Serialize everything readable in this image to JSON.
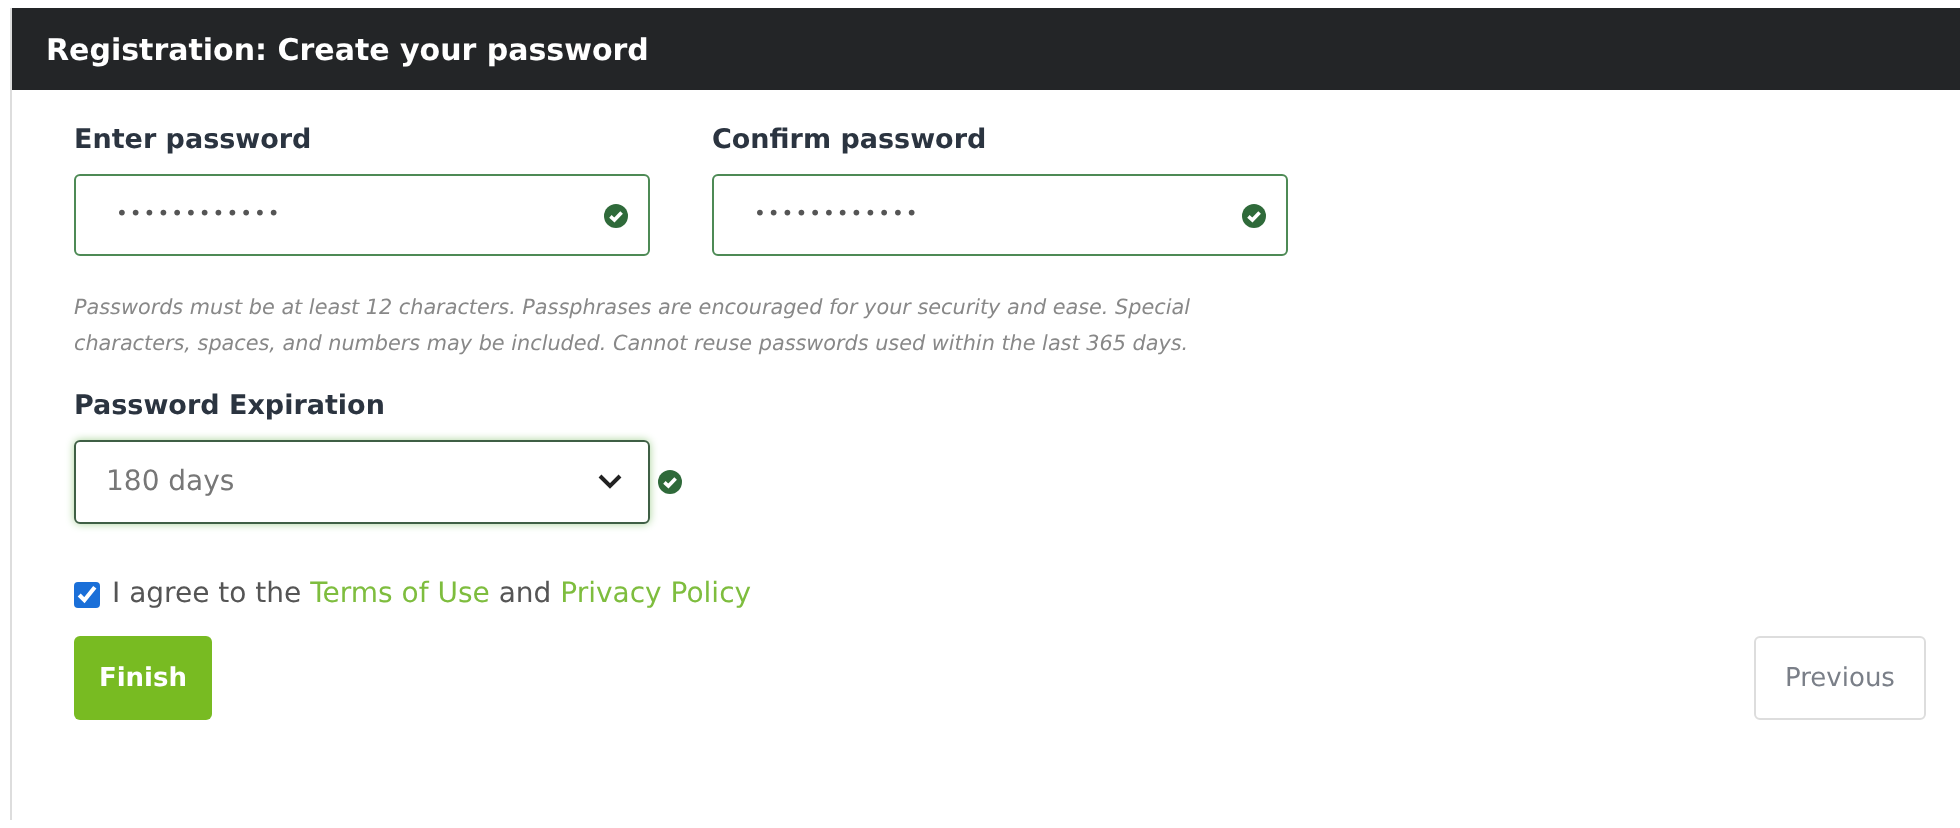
{
  "header": {
    "title": "Registration: Create your password"
  },
  "password_fields": [
    {
      "label": "Enter password",
      "value": "••••••••••••",
      "valid": true
    },
    {
      "label": "Confirm password",
      "value": "••••••••••••",
      "valid": true
    }
  ],
  "hint": "Passwords must be at least 12 characters. Passphrases are encouraged for your security and ease. Special characters, spaces, and numbers may be included. Cannot reuse passwords used within the last 365 days.",
  "expiration": {
    "label": "Password Expiration",
    "value": "180 days",
    "valid": true
  },
  "agreement": {
    "checked": true,
    "parts": [
      {
        "kind": "text",
        "text": "I agree to the "
      },
      {
        "kind": "link",
        "text": "Terms of Use"
      },
      {
        "kind": "text",
        "text": " and "
      },
      {
        "kind": "link",
        "text": "Privacy Policy"
      }
    ]
  },
  "buttons": [
    {
      "kind": "primary",
      "label": "Finish"
    },
    {
      "kind": "secondary",
      "label": "Previous"
    }
  ]
}
